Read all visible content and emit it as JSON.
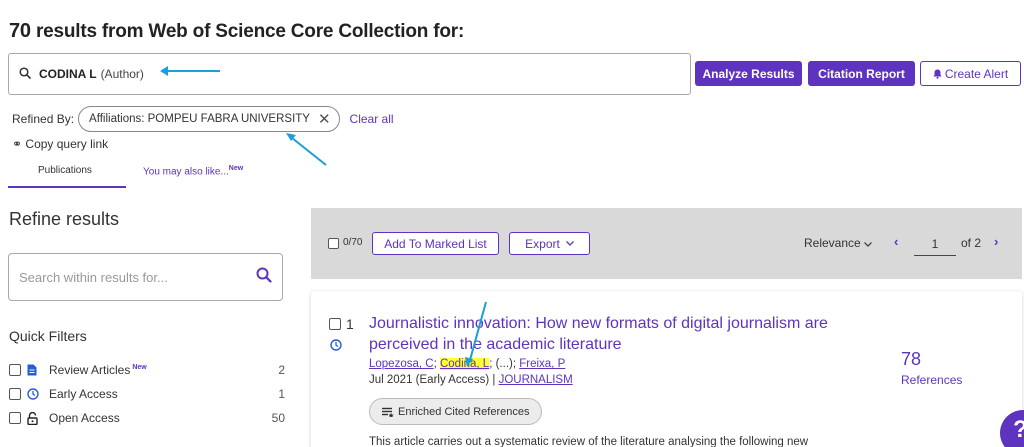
{
  "header": {
    "count": "70",
    "title_rest": " results from Web of Science Core Collection for:"
  },
  "query": {
    "term": "CODINA L",
    "field": "(Author)"
  },
  "actions": {
    "analyze": "Analyze Results",
    "citation": "Citation Report",
    "alert": "Create Alert"
  },
  "refined": {
    "label": "Refined By:",
    "chip": "Affiliations: POMPEU FABRA UNIVERSITY",
    "clear_all": "Clear all",
    "copy_link": "Copy query link"
  },
  "tabs": {
    "publications": "Publications",
    "also_like": "You may also like...",
    "new_badge": "New"
  },
  "sidebar": {
    "refine_title": "Refine results",
    "search_placeholder": "Search within results for...",
    "quick_filters_title": "Quick Filters",
    "filters": [
      {
        "label": "Review Articles",
        "badge": "New",
        "count": "2",
        "icon": "document-icon"
      },
      {
        "label": "Early Access",
        "badge": "",
        "count": "1",
        "icon": "clock-icon"
      },
      {
        "label": "Open Access",
        "badge": "",
        "count": "50",
        "icon": "unlock-icon"
      }
    ]
  },
  "toolbar": {
    "selected": "0/70",
    "add_marked": "Add To Marked List",
    "export": "Export",
    "sort": "Relevance",
    "page": "1",
    "of_pages": "of 2"
  },
  "result": {
    "index": "1",
    "title": "Journalistic innovation: How new formats of digital journalism are perceived in the academic literature",
    "author1": "Lopezosa, C",
    "author2": "Codina, L",
    "ellipsis": "(...)",
    "author3": "Freixa, P",
    "date": "Jul 2021 (Early Access)",
    "journal": "JOURNALISM",
    "enrich": "Enriched Cited References",
    "abstract": "This article carries out a systematic review of the literature analysing the following new",
    "refs_count": "78",
    "refs_label": "References"
  },
  "colors": {
    "accent": "#5e33bf",
    "highlight": "#ffff33",
    "arrow": "#1a9fd8",
    "toolbar_bg": "#d9d9d9"
  }
}
